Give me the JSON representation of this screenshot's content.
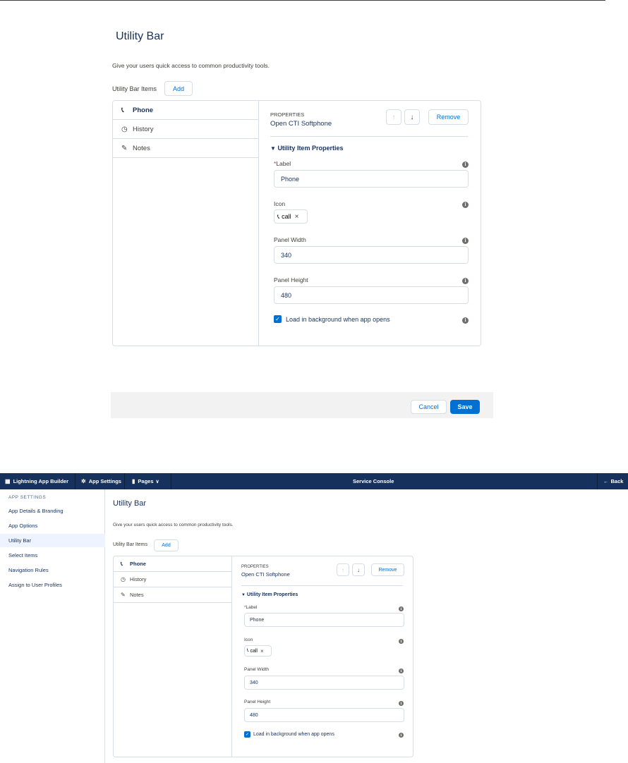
{
  "zoomed": {
    "title": "Utility Bar",
    "description": "Give your users quick access to common productivity tools.",
    "items_label": "Utility Bar Items",
    "add_label": "Add",
    "list": [
      {
        "icon": "phone-icon",
        "label": "Phone",
        "active": true
      },
      {
        "icon": "clock-icon",
        "label": "History",
        "active": false
      },
      {
        "icon": "note-icon",
        "label": "Notes",
        "active": false
      }
    ],
    "properties_label": "PROPERTIES",
    "properties_name": "Open CTI Softphone",
    "remove_label": "Remove",
    "section_title": "Utility Item Properties",
    "label_field": {
      "required_mark": "*",
      "label": "Label",
      "value": "Phone"
    },
    "icon_field": {
      "label": "Icon",
      "value": "call"
    },
    "width_field": {
      "label": "Panel Width",
      "value": "340"
    },
    "height_field": {
      "label": "Panel Height",
      "value": "480"
    },
    "background_checkbox": {
      "label": "Load in background when app opens",
      "checked": true
    },
    "cancel_label": "Cancel",
    "save_label": "Save"
  },
  "app": {
    "nav": {
      "brand": "Lightning App Builder",
      "app_settings": "App Settings",
      "pages": "Pages",
      "center_title": "Service Console",
      "back": "Back"
    },
    "sidebar": {
      "heading": "APP SETTINGS",
      "items": [
        {
          "label": "App Details & Branding",
          "active": false
        },
        {
          "label": "App Options",
          "active": false
        },
        {
          "label": "Utility Bar",
          "active": true
        },
        {
          "label": "Select Items",
          "active": false
        },
        {
          "label": "Navigation Rules",
          "active": false
        },
        {
          "label": "Assign to User Profiles",
          "active": false
        }
      ]
    },
    "title": "Utility Bar",
    "description": "Give your users quick access to common productivity tools.",
    "items_label": "Utility Bar Items",
    "add_label": "Add",
    "list": [
      {
        "icon": "phone-icon",
        "label": "Phone",
        "active": true
      },
      {
        "icon": "clock-icon",
        "label": "History",
        "active": false
      },
      {
        "icon": "note-icon",
        "label": "Notes",
        "active": false
      }
    ],
    "properties_label": "PROPERTIES",
    "properties_name": "Open CTI Softphone",
    "remove_label": "Remove",
    "section_title": "Utility Item Properties",
    "label_field": {
      "required_mark": "*",
      "label": "Label",
      "value": "Phone"
    },
    "icon_field": {
      "label": "Icon",
      "value": "call"
    },
    "width_field": {
      "label": "Panel Width",
      "value": "340"
    },
    "height_field": {
      "label": "Panel Height",
      "value": "480"
    },
    "background_checkbox": {
      "label": "Load in background when app opens",
      "checked": true
    }
  },
  "colors": {
    "brand_blue": "#0070d2",
    "nav_navy": "#16325c",
    "text_dark": "#16325c",
    "border": "#d8dde6",
    "footer_bg": "#f3f2f2",
    "required_red": "#c23934"
  }
}
